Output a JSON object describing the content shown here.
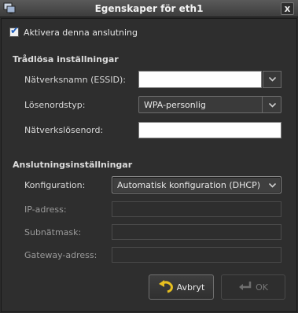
{
  "window": {
    "title": "Egenskaper för eth1",
    "close_glyph": "x",
    "icon": "network-window-icon"
  },
  "activate": {
    "label": "Aktivera denna anslutning",
    "checked": true
  },
  "wireless": {
    "section_title": "Trådlösa inställningar",
    "essid_label": "Nätverksnamn (ESSID):",
    "essid_value": "",
    "password_type_label": "Lösenordstyp:",
    "password_type_value": "WPA-personlig",
    "password_label": "Nätverkslösenord:",
    "password_value": ""
  },
  "connection": {
    "section_title": "Anslutningsinställningar",
    "config_label": "Konfiguration:",
    "config_value": "Automatisk konfiguration (DHCP)",
    "ip_label": "IP-adress:",
    "ip_value": "",
    "subnet_label": "Subnätmask:",
    "subnet_value": "",
    "gateway_label": "Gateway-adress:",
    "gateway_value": ""
  },
  "buttons": {
    "cancel_label": "Avbryt",
    "ok_label": "OK",
    "ok_enabled": false
  },
  "colors": {
    "background": "#2e2e2e",
    "accent_check": "#1f5fbf",
    "cancel_icon": "#e8c020"
  }
}
